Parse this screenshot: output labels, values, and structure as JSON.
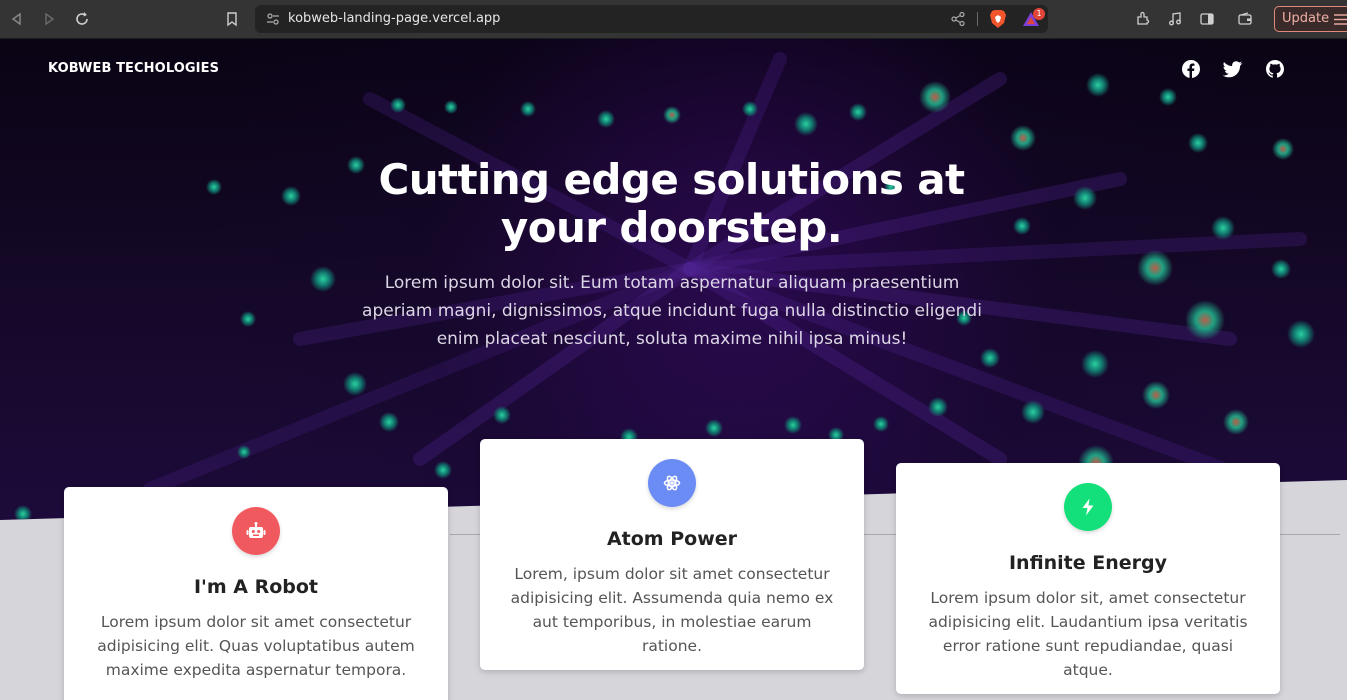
{
  "browser": {
    "url": "kobweb-landing-page.vercel.app",
    "update_label": "Update",
    "notification_count": "1"
  },
  "nav": {
    "brand": "KOBWEB TECHOLOGIES",
    "social_icons": [
      "facebook-icon",
      "twitter-icon",
      "github-icon"
    ]
  },
  "hero": {
    "headline_line1": "Cutting edge solutions at",
    "headline_line2": "your doorstep.",
    "lede": "Lorem ipsum dolor sit. Eum totam aspernatur aliquam praesentium aperiam magni, dignissimos, atque incidunt fuga nulla distinctio eligendi enim placeat nesciunt, soluta maxime nihil ipsa minus!"
  },
  "features": [
    {
      "icon": "robot-icon",
      "title": "I'm A Robot",
      "desc": "Lorem ipsum dolor sit amet consectetur adipisicing elit. Quas voluptatibus autem maxime expedita aspernatur tempora.",
      "color": "#f05a5f"
    },
    {
      "icon": "atom-icon",
      "title": "Atom Power",
      "desc": "Lorem, ipsum dolor sit amet consectetur adipisicing elit. Assumenda quia nemo ex aut temporibus, in molestiae earum ratione.",
      "color": "#6c8cf5"
    },
    {
      "icon": "bolt-icon",
      "title": "Infinite Energy",
      "desc": "Lorem ipsum dolor sit, amet consectetur adipisicing elit. Laudantium ipsa veritatis error ratione sunt repudiandae, quasi atque.",
      "color": "#13e07a"
    }
  ]
}
